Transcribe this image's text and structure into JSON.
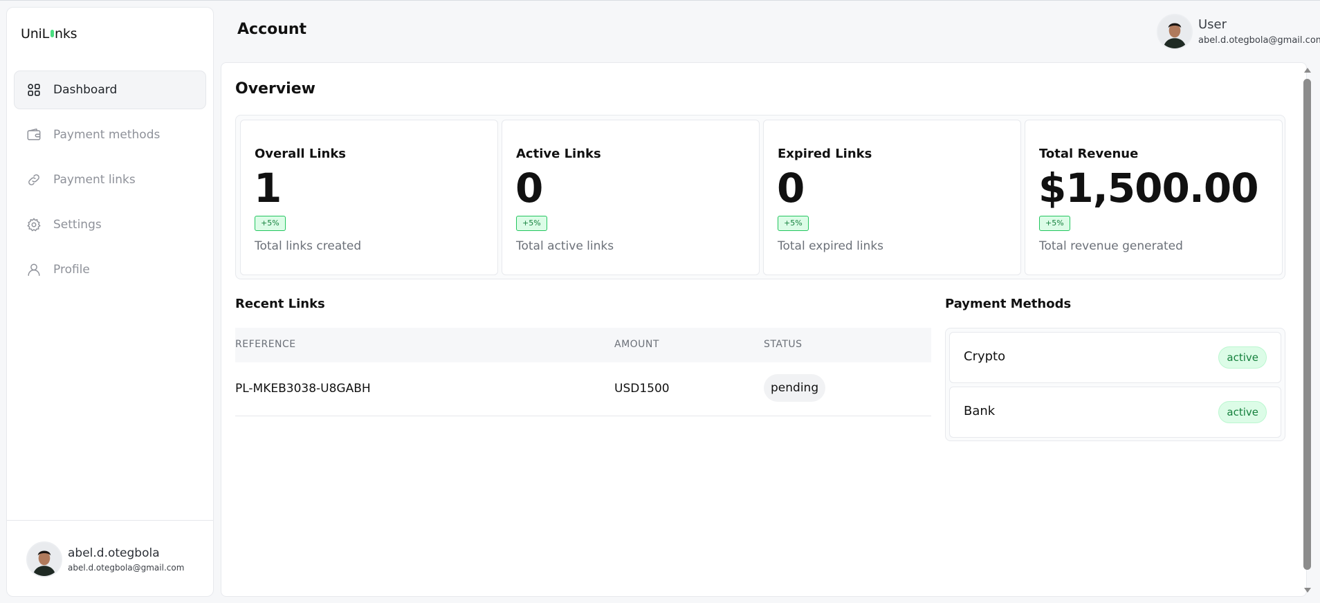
{
  "app": {
    "logo_part1": "UniL",
    "logo_part2": "nks"
  },
  "sidebar": {
    "items": [
      {
        "label": "Dashboard",
        "icon": "grid-icon"
      },
      {
        "label": "Payment methods",
        "icon": "wallet-icon"
      },
      {
        "label": "Payment links",
        "icon": "link-icon"
      },
      {
        "label": "Settings",
        "icon": "gear-icon"
      },
      {
        "label": "Profile",
        "icon": "user-icon"
      }
    ],
    "active": "Dashboard",
    "user": {
      "name": "abel.d.otegbola",
      "email": "abel.d.otegbola@gmail.com"
    }
  },
  "header": {
    "title": "Account",
    "user": {
      "name": "User",
      "email": "abel.d.otegbola@gmail.com"
    }
  },
  "overview": {
    "title": "Overview",
    "stats": [
      {
        "title": "Overall Links",
        "value": "1",
        "badge": "+5%",
        "desc": "Total links created"
      },
      {
        "title": "Active Links",
        "value": "0",
        "badge": "+5%",
        "desc": "Total active links"
      },
      {
        "title": "Expired Links",
        "value": "0",
        "badge": "+5%",
        "desc": "Total expired links"
      },
      {
        "title": "Total Revenue",
        "value": "$1,500.00",
        "badge": "+5%",
        "desc": "Total revenue generated"
      }
    ]
  },
  "recent_links": {
    "title": "Recent Links",
    "columns": [
      "REFERENCE",
      "AMOUNT",
      "STATUS"
    ],
    "rows": [
      {
        "reference": "PL-MKEB3038-U8GABH",
        "amount": "USD1500",
        "status": "pending"
      }
    ]
  },
  "payment_methods": {
    "title": "Payment Methods",
    "items": [
      {
        "name": "Crypto",
        "status": "active"
      },
      {
        "name": "Bank",
        "status": "active"
      }
    ]
  },
  "colors": {
    "accent_green": "#4ade80",
    "badge_green_text": "#15803d",
    "badge_green_bg": "#dcfce7"
  }
}
